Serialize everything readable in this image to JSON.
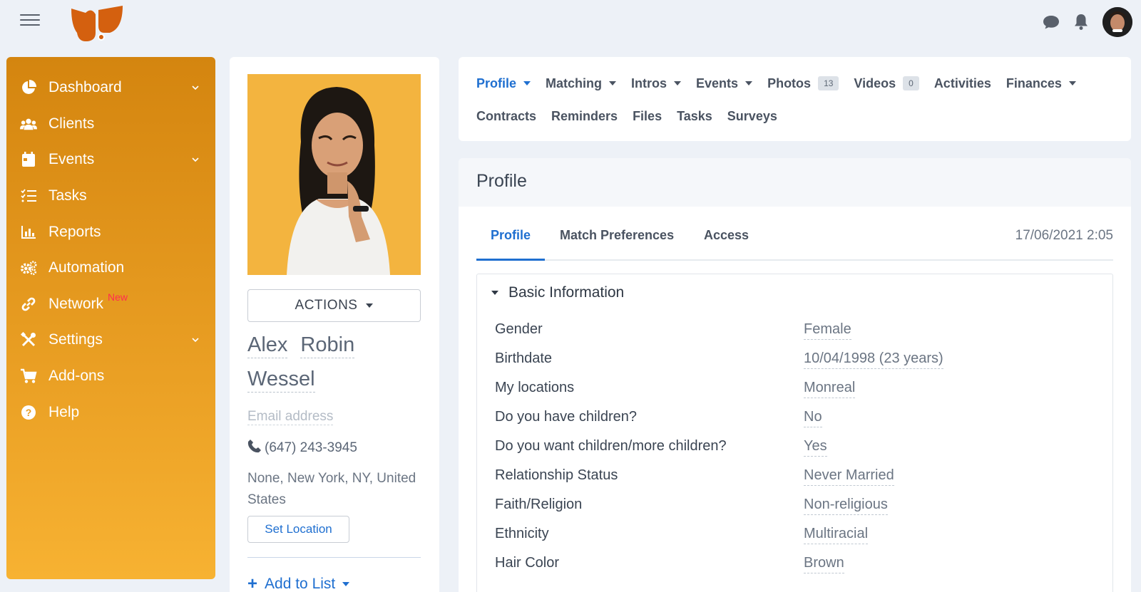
{
  "topbar": {
    "menu_icon": "hamburger-menu-icon",
    "logo_icon": "bird-logo-icon",
    "icons": [
      "chat-bubble-icon",
      "bell-icon",
      "user-avatar"
    ]
  },
  "sidebar": {
    "items": [
      {
        "label": "Dashboard",
        "icon": "pie-chart-icon",
        "has_chevron": true
      },
      {
        "label": "Clients",
        "icon": "users-icon",
        "has_chevron": false
      },
      {
        "label": "Events",
        "icon": "calendar-icon",
        "has_chevron": true
      },
      {
        "label": "Tasks",
        "icon": "checklist-icon",
        "has_chevron": false
      },
      {
        "label": "Reports",
        "icon": "bar-chart-icon",
        "has_chevron": false
      },
      {
        "label": "Automation",
        "icon": "gears-icon",
        "has_chevron": false
      },
      {
        "label": "Network",
        "icon": "link-icon",
        "has_chevron": false,
        "badge": "New"
      },
      {
        "label": "Settings",
        "icon": "tools-icon",
        "has_chevron": true
      },
      {
        "label": "Add-ons",
        "icon": "cart-icon",
        "has_chevron": false
      },
      {
        "label": "Help",
        "icon": "question-circle-icon",
        "has_chevron": false
      }
    ]
  },
  "client": {
    "actions_label": "ACTIONS",
    "first_name": "Alex",
    "middle_name": "Robin",
    "last_name": "Wessel",
    "email_placeholder": "Email address",
    "phone": "(647) 243-3945",
    "address": "None, New York, NY, United States",
    "set_location_label": "Set Location",
    "add_to_list_label": "Add to List"
  },
  "tabs": {
    "row1": [
      {
        "label": "Profile",
        "active": true,
        "dropdown": true
      },
      {
        "label": "Matching",
        "dropdown": true
      },
      {
        "label": "Intros",
        "dropdown": true
      },
      {
        "label": "Events",
        "dropdown": true
      },
      {
        "label": "Photos",
        "count": "13"
      },
      {
        "label": "Videos",
        "count": "0"
      },
      {
        "label": "Activities"
      },
      {
        "label": "Finances",
        "dropdown": true
      }
    ],
    "row2": [
      {
        "label": "Contracts"
      },
      {
        "label": "Reminders"
      },
      {
        "label": "Files"
      },
      {
        "label": "Tasks"
      },
      {
        "label": "Surveys"
      }
    ]
  },
  "profile": {
    "heading": "Profile",
    "subtabs": [
      "Profile",
      "Match Preferences",
      "Access"
    ],
    "timestamp": "17/06/2021 2:05",
    "section_title": "Basic Information",
    "fields": [
      {
        "label": "Gender",
        "value": "Female"
      },
      {
        "label": "Birthdate",
        "value": "10/04/1998 (23 years)"
      },
      {
        "label": "My locations",
        "value": "Monreal"
      },
      {
        "label": "Do you have children?",
        "value": "No"
      },
      {
        "label": "Do you want children/more children?",
        "value": "Yes"
      },
      {
        "label": "Relationship Status",
        "value": "Never Married"
      },
      {
        "label": "Faith/Religion",
        "value": "Non-religious"
      },
      {
        "label": "Ethnicity",
        "value": "Multiracial"
      },
      {
        "label": "Hair Color",
        "value": "Brown"
      }
    ]
  },
  "colors": {
    "accent_blue": "#1f6fd0",
    "sidebar_top": "#d4850f",
    "sidebar_bottom": "#f7b232",
    "logo_orange": "#d4600f",
    "new_badge": "#ff2d4f"
  }
}
